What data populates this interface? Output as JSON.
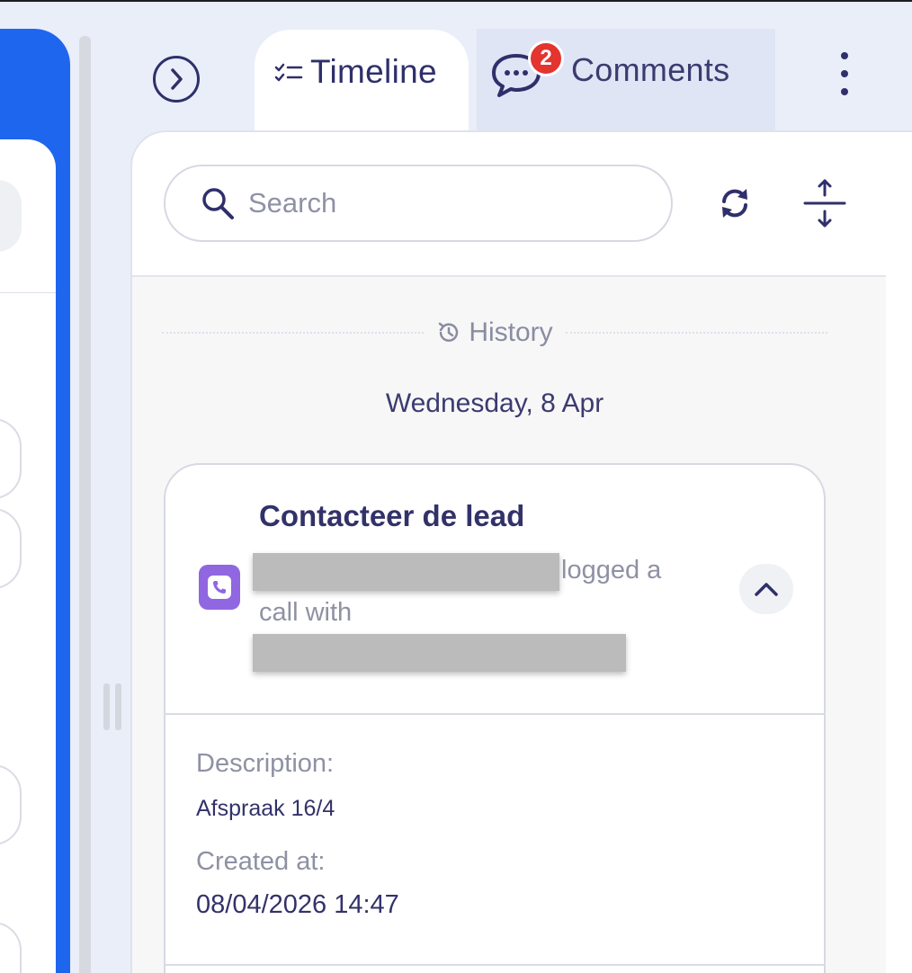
{
  "tabs": {
    "timeline_label": "Timeline",
    "comments_label": "Comments",
    "comments_badge": "2"
  },
  "search": {
    "placeholder": "Search"
  },
  "feed": {
    "section_label": "History",
    "date_heading": "Wednesday, 8 Apr"
  },
  "activity": {
    "title": "Contacteer de lead",
    "action_text": "logged a",
    "action_text_2": "call with",
    "description_label": "Description:",
    "description_value": "Afspraak 16/4",
    "created_label": "Created at:",
    "created_value": "08/04/2026 14:47"
  },
  "colors": {
    "accent_blue": "#1f66ee",
    "text_navy": "#2f2f6b",
    "badge_red": "#e3342f",
    "call_purple": "#9067e0"
  },
  "icons": [
    "chevron-right-circle-icon",
    "task-list-icon",
    "chat-bubble-icon",
    "kebab-menu-icon",
    "search-icon",
    "refresh-icon",
    "expand-vertical-icon",
    "clock-history-icon",
    "phone-icon",
    "chevron-up-icon"
  ]
}
